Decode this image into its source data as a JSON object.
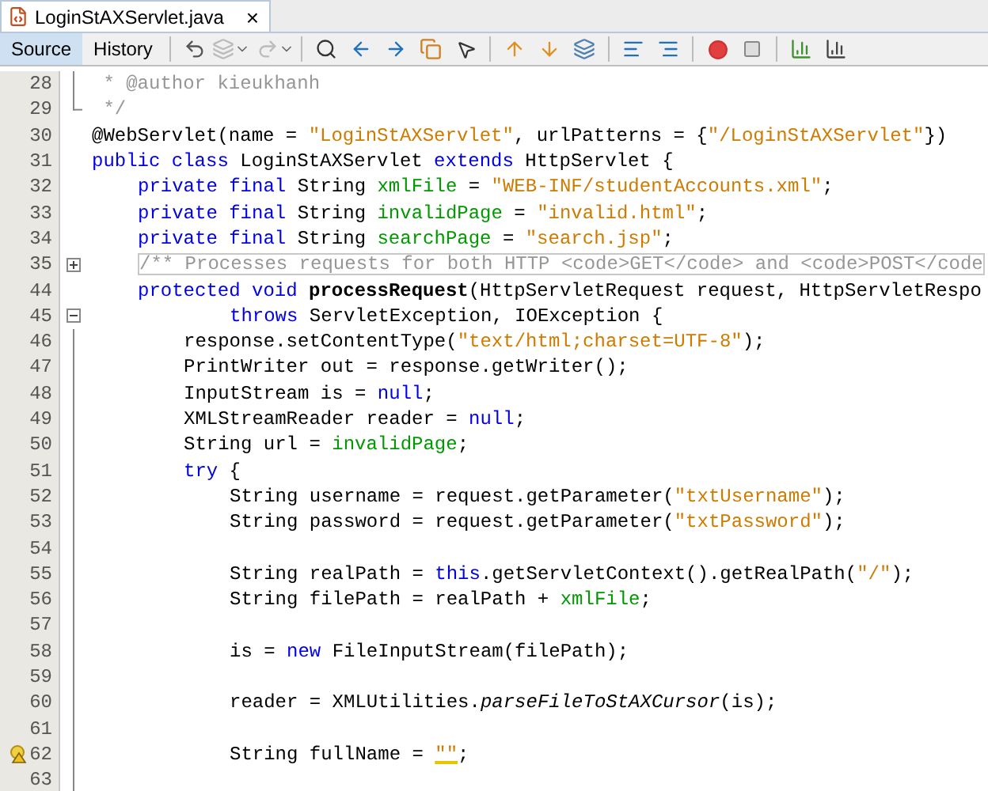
{
  "editor_tabs": [
    {
      "label": "LoginStAXServlet.java",
      "selected": true,
      "close": "×"
    }
  ],
  "view_tabs": [
    {
      "label": "Source",
      "selected": true
    },
    {
      "label": "History",
      "selected": false
    }
  ],
  "lines": [
    {
      "number": "28",
      "kind": "top",
      "tokens": [
        {
          "kind": "comment",
          "text": " * @author kieukhanh"
        }
      ]
    },
    {
      "number": "29",
      "kind": "top",
      "tokens": [
        {
          "kind": "comment",
          "text": " */"
        }
      ]
    },
    {
      "number": "30",
      "kind": "top",
      "tokens": [
        {
          "kind": "plain",
          "text": "@WebServlet(name = "
        },
        {
          "kind": "string",
          "text": "\"LoginStAXServlet\""
        },
        {
          "kind": "plain",
          "text": ", urlPatterns = {"
        },
        {
          "kind": "string",
          "text": "\"/LoginStAXServlet\""
        },
        {
          "kind": "plain",
          "text": "})"
        }
      ]
    },
    {
      "number": "31",
      "kind": "top",
      "tokens": [
        {
          "kind": "keyword",
          "text": "public class"
        },
        {
          "kind": "plain",
          "text": " LoginStAXServlet "
        },
        {
          "kind": "keyword",
          "text": "extends"
        },
        {
          "kind": "plain",
          "text": " HttpServlet {"
        }
      ]
    },
    {
      "number": "32",
      "kind": "member",
      "tokens": [
        {
          "kind": "keyword",
          "text": "private final"
        },
        {
          "kind": "plain",
          "text": " String "
        },
        {
          "kind": "field",
          "text": "xmlFile"
        },
        {
          "kind": "plain",
          "text": " = "
        },
        {
          "kind": "string",
          "text": "\"WEB-INF/studentAccounts.xml\""
        },
        {
          "kind": "plain",
          "text": ";"
        }
      ]
    },
    {
      "number": "33",
      "kind": "member",
      "tokens": [
        {
          "kind": "keyword",
          "text": "private final"
        },
        {
          "kind": "plain",
          "text": " String "
        },
        {
          "kind": "field",
          "text": "invalidPage"
        },
        {
          "kind": "plain",
          "text": " = "
        },
        {
          "kind": "string",
          "text": "\"invalid.html\""
        },
        {
          "kind": "plain",
          "text": ";"
        }
      ]
    },
    {
      "number": "34",
      "kind": "member",
      "tokens": [
        {
          "kind": "keyword",
          "text": "private final"
        },
        {
          "kind": "plain",
          "text": " String "
        },
        {
          "kind": "field",
          "text": "searchPage"
        },
        {
          "kind": "plain",
          "text": " = "
        },
        {
          "kind": "string",
          "text": "\"search.jsp\""
        },
        {
          "kind": "plain",
          "text": ";"
        }
      ]
    },
    {
      "number": "35",
      "kind": "member",
      "fold_box": {
        "collapsed": true
      },
      "tokens": [
        {
          "kind": "folded",
          "text": "/** Processes requests for both HTTP <code>GET</code> and <code>POST</code"
        }
      ]
    },
    {
      "number": "44",
      "kind": "member",
      "tokens": [
        {
          "kind": "keyword",
          "text": "protected void "
        },
        {
          "kind": "method",
          "text": "processRequest"
        },
        {
          "kind": "plain",
          "text": "(HttpServletRequest request, HttpServletRespo"
        }
      ]
    },
    {
      "number": "45",
      "kind": "nested",
      "fold_box": {
        "collapsed": false
      },
      "tokens": [
        {
          "kind": "keyword",
          "text": "throws"
        },
        {
          "kind": "plain",
          "text": " ServletException, IOException {"
        }
      ]
    },
    {
      "number": "46",
      "kind": "body",
      "tokens": [
        {
          "kind": "plain",
          "text": "response.setContentType("
        },
        {
          "kind": "string",
          "text": "\"text/html;charset=UTF-8\""
        },
        {
          "kind": "plain",
          "text": ");"
        }
      ]
    },
    {
      "number": "47",
      "kind": "body",
      "tokens": [
        {
          "kind": "plain",
          "text": "PrintWriter out = response.getWriter();"
        }
      ]
    },
    {
      "number": "48",
      "kind": "body",
      "tokens": [
        {
          "kind": "plain",
          "text": "InputStream is = "
        },
        {
          "kind": "keyword",
          "text": "null"
        },
        {
          "kind": "plain",
          "text": ";"
        }
      ]
    },
    {
      "number": "49",
      "kind": "body",
      "tokens": [
        {
          "kind": "plain",
          "text": "XMLStreamReader reader = "
        },
        {
          "kind": "keyword",
          "text": "null"
        },
        {
          "kind": "plain",
          "text": ";"
        }
      ]
    },
    {
      "number": "50",
      "kind": "body",
      "tokens": [
        {
          "kind": "plain",
          "text": "String url = "
        },
        {
          "kind": "field",
          "text": "invalidPage"
        },
        {
          "kind": "plain",
          "text": ";"
        }
      ]
    },
    {
      "number": "51",
      "kind": "body",
      "tokens": [
        {
          "kind": "keyword",
          "text": "try"
        },
        {
          "kind": "plain",
          "text": " {"
        }
      ]
    },
    {
      "number": "52",
      "kind": "nested",
      "tokens": [
        {
          "kind": "plain",
          "text": "String username = request.getParameter("
        },
        {
          "kind": "string",
          "text": "\"txtUsername\""
        },
        {
          "kind": "plain",
          "text": ");"
        }
      ]
    },
    {
      "number": "53",
      "kind": "nested",
      "tokens": [
        {
          "kind": "plain",
          "text": "String password = request.getParameter("
        },
        {
          "kind": "string",
          "text": "\"txtPassword\""
        },
        {
          "kind": "plain",
          "text": ");"
        }
      ]
    },
    {
      "number": "54",
      "kind": "blank"
    },
    {
      "number": "55",
      "kind": "nested",
      "tokens": [
        {
          "kind": "plain",
          "text": "String realPath = "
        },
        {
          "kind": "keyword",
          "text": "this"
        },
        {
          "kind": "plain",
          "text": ".getServletContext().getRealPath("
        },
        {
          "kind": "string",
          "text": "\"/\""
        },
        {
          "kind": "plain",
          "text": ");"
        }
      ]
    },
    {
      "number": "56",
      "kind": "nested",
      "tokens": [
        {
          "kind": "plain",
          "text": "String filePath = realPath + "
        },
        {
          "kind": "field",
          "text": "xmlFile"
        },
        {
          "kind": "plain",
          "text": ";"
        }
      ]
    },
    {
      "number": "57",
      "kind": "blank"
    },
    {
      "number": "58",
      "kind": "nested",
      "tokens": [
        {
          "kind": "plain",
          "text": "is = "
        },
        {
          "kind": "keyword",
          "text": "new"
        },
        {
          "kind": "plain",
          "text": " FileInputStream(filePath);"
        }
      ]
    },
    {
      "number": "59",
      "kind": "blank"
    },
    {
      "number": "60",
      "kind": "nested",
      "tokens": [
        {
          "kind": "plain",
          "text": "reader = XMLUtilities."
        },
        {
          "kind": "static",
          "text": "parseFileToStAXCursor"
        },
        {
          "kind": "plain",
          "text": "(is);"
        }
      ]
    },
    {
      "number": "61",
      "kind": "blank"
    },
    {
      "number": "62",
      "warning": true,
      "kind": "nested",
      "tokens": [
        {
          "kind": "plain",
          "text": "String fullName = "
        },
        {
          "kind": "string_warning",
          "text": "\"\""
        },
        {
          "kind": "plain",
          "text": ";"
        }
      ]
    },
    {
      "number": "63",
      "kind": "blank"
    }
  ]
}
